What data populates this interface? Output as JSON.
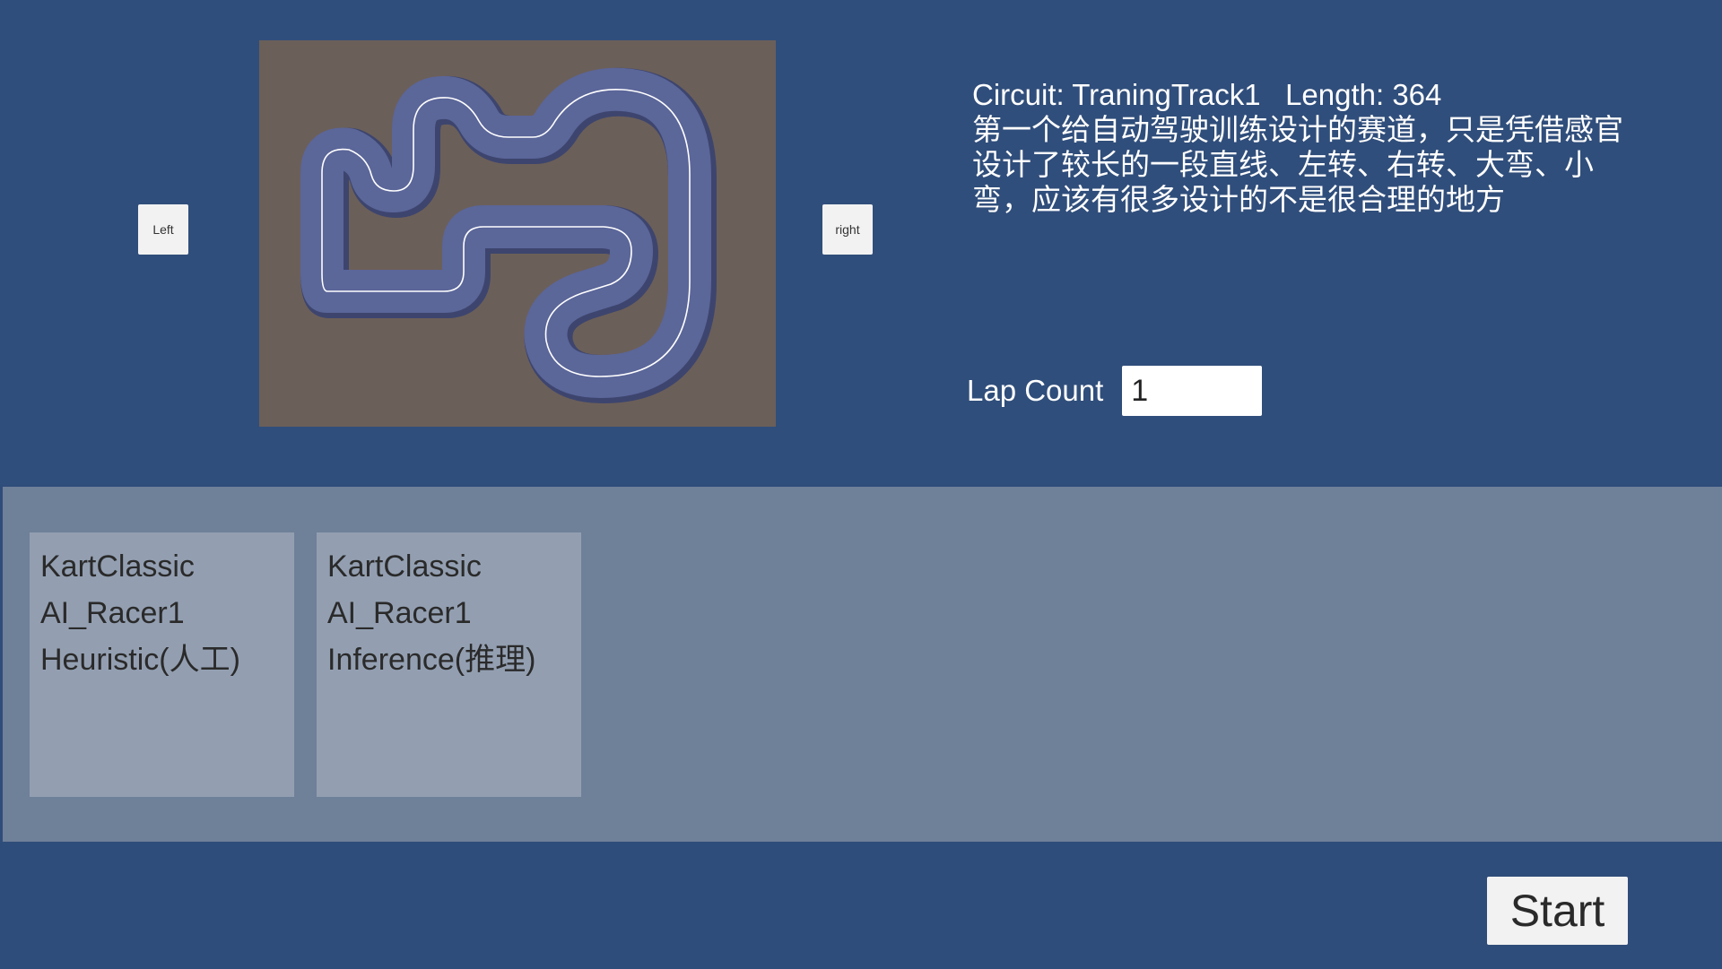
{
  "track_selector": {
    "left_label": "Left",
    "right_label": "right"
  },
  "circuit": {
    "name_line": "Circuit: TraningTrack1",
    "length_line": "Length: 364",
    "description": "第一个给自动驾驶训练设计的赛道，只是凭借感官设计了较长的一段直线、左转、右转、大弯、小弯，应该有很多设计的不是很合理的地方"
  },
  "lap_count": {
    "label": "Lap Count",
    "value": "1"
  },
  "racers": [
    {
      "kart": "KartClassic",
      "name": "AI_Racer1",
      "mode": "Heuristic(人工)"
    },
    {
      "kart": "KartClassic",
      "name": "AI_Racer1",
      "mode": "Inference(推理)"
    }
  ],
  "start_label": "Start",
  "colors": {
    "background": "#304e7b",
    "racers_panel": "#6f8099",
    "racer_card": "#939fb1",
    "track_ground": "#6b5f59",
    "track_road": "#5b6699"
  }
}
